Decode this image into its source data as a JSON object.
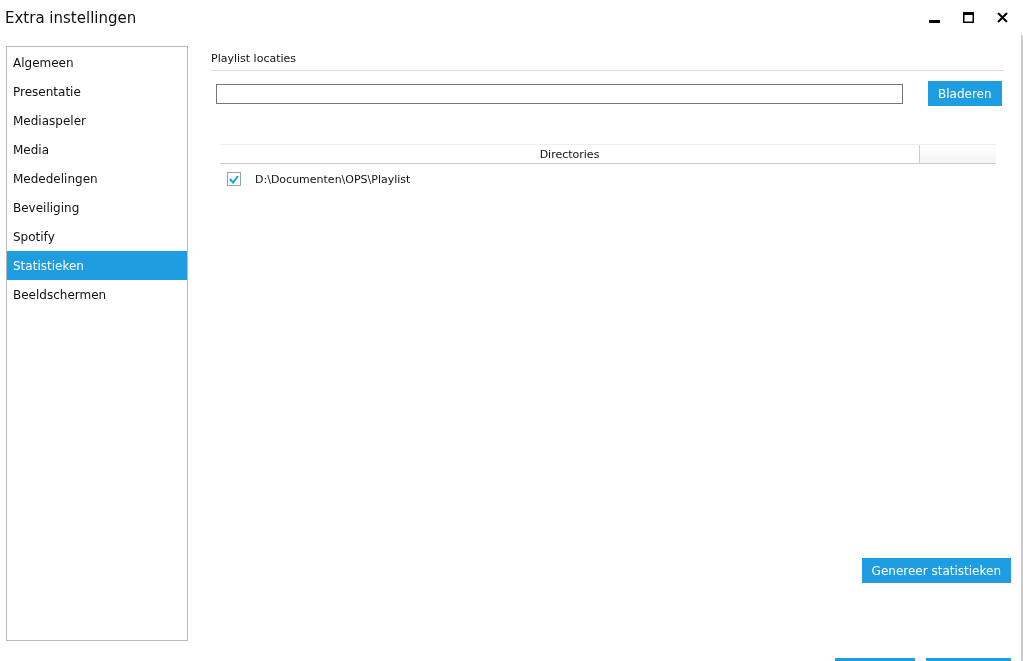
{
  "window": {
    "title": "Extra instellingen"
  },
  "sidebar": {
    "items": [
      {
        "label": "Algemeen",
        "selected": false
      },
      {
        "label": "Presentatie",
        "selected": false
      },
      {
        "label": "Mediaspeler",
        "selected": false
      },
      {
        "label": "Media",
        "selected": false
      },
      {
        "label": "Mededelingen",
        "selected": false
      },
      {
        "label": "Beveiliging",
        "selected": false
      },
      {
        "label": "Spotify",
        "selected": false
      },
      {
        "label": "Statistieken",
        "selected": true
      },
      {
        "label": "Beeldschermen",
        "selected": false
      }
    ]
  },
  "section": {
    "title": "Playlist locaties",
    "browse_button": "Bladeren"
  },
  "table": {
    "columns": [
      "Directories"
    ],
    "rows": [
      {
        "path": "D:\\Documenten\\OPS\\Playlist",
        "checked": true
      }
    ]
  },
  "generate_button": "Genereer statistieken"
}
